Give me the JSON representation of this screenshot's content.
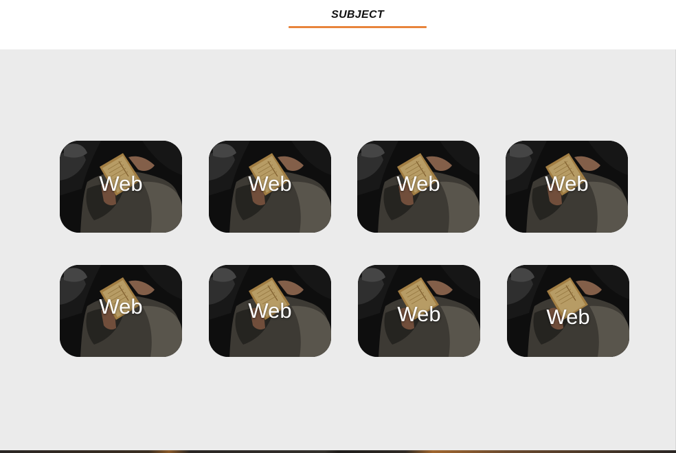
{
  "header": {
    "title": "SUBJECT",
    "accent_color": "#e8843c"
  },
  "content": {
    "background_color": "#ebebeb"
  },
  "cards": [
    {
      "label": "Web",
      "image": "person-reading-book-photo"
    },
    {
      "label": "Web",
      "image": "person-reading-book-photo"
    },
    {
      "label": "Web",
      "image": "person-reading-book-photo"
    },
    {
      "label": "Web",
      "image": "person-reading-book-photo"
    },
    {
      "label": "Web",
      "image": "person-reading-book-photo"
    },
    {
      "label": "Web",
      "image": "person-reading-book-photo"
    },
    {
      "label": "Web",
      "image": "person-reading-book-photo"
    },
    {
      "label": "Web",
      "image": "person-reading-book-photo"
    }
  ]
}
